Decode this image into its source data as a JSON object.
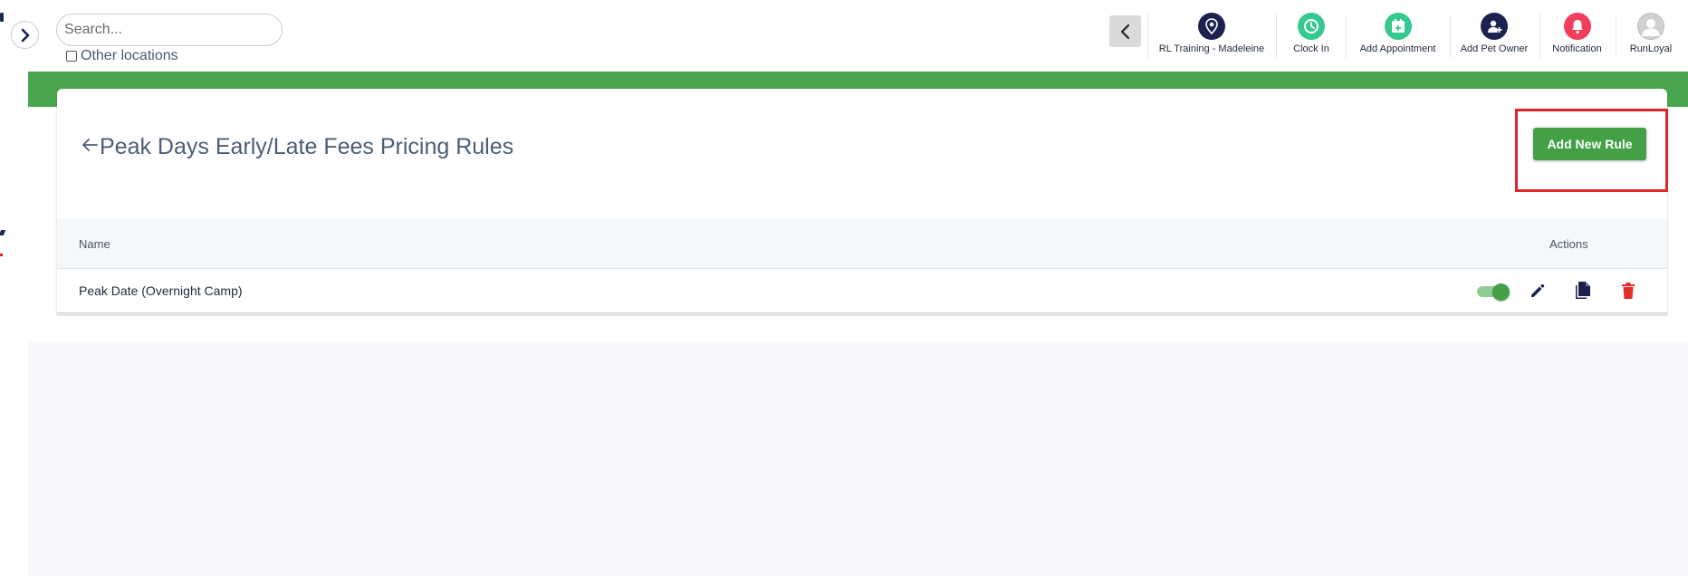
{
  "search": {
    "placeholder": "Search..."
  },
  "other_locations": {
    "label": "Other locations",
    "checked": false
  },
  "toolbar": {
    "items": [
      {
        "label": "RL Training - Madeleine",
        "icon": "location-pin-icon",
        "color": "#1b2250"
      },
      {
        "label": "Clock In",
        "icon": "clock-icon",
        "color": "#34c98e"
      },
      {
        "label": "Add Appointment",
        "icon": "calendar-add-icon",
        "color": "#34c98e"
      },
      {
        "label": "Add Pet Owner",
        "icon": "add-user-icon",
        "color": "#1b2250"
      },
      {
        "label": "Notification",
        "icon": "bell-icon",
        "color": "#f23d5c"
      },
      {
        "label": "RunLoyal",
        "icon": "avatar-icon",
        "color": "#d0d0d0"
      }
    ]
  },
  "header": {
    "title": "Peak Days Early/Late Fees Pricing Rules"
  },
  "add_rule_button": {
    "label": "Add New Rule"
  },
  "table": {
    "columns": {
      "name": "Name",
      "actions": "Actions"
    },
    "rows": [
      {
        "name": "Peak Date (Overnight Camp)",
        "enabled": true
      }
    ]
  },
  "colors": {
    "brand_green": "#4aa64e",
    "button_green": "#43a047",
    "highlight_red": "#e0262b",
    "delete_red": "#e52b2b",
    "navy": "#1b2250"
  }
}
